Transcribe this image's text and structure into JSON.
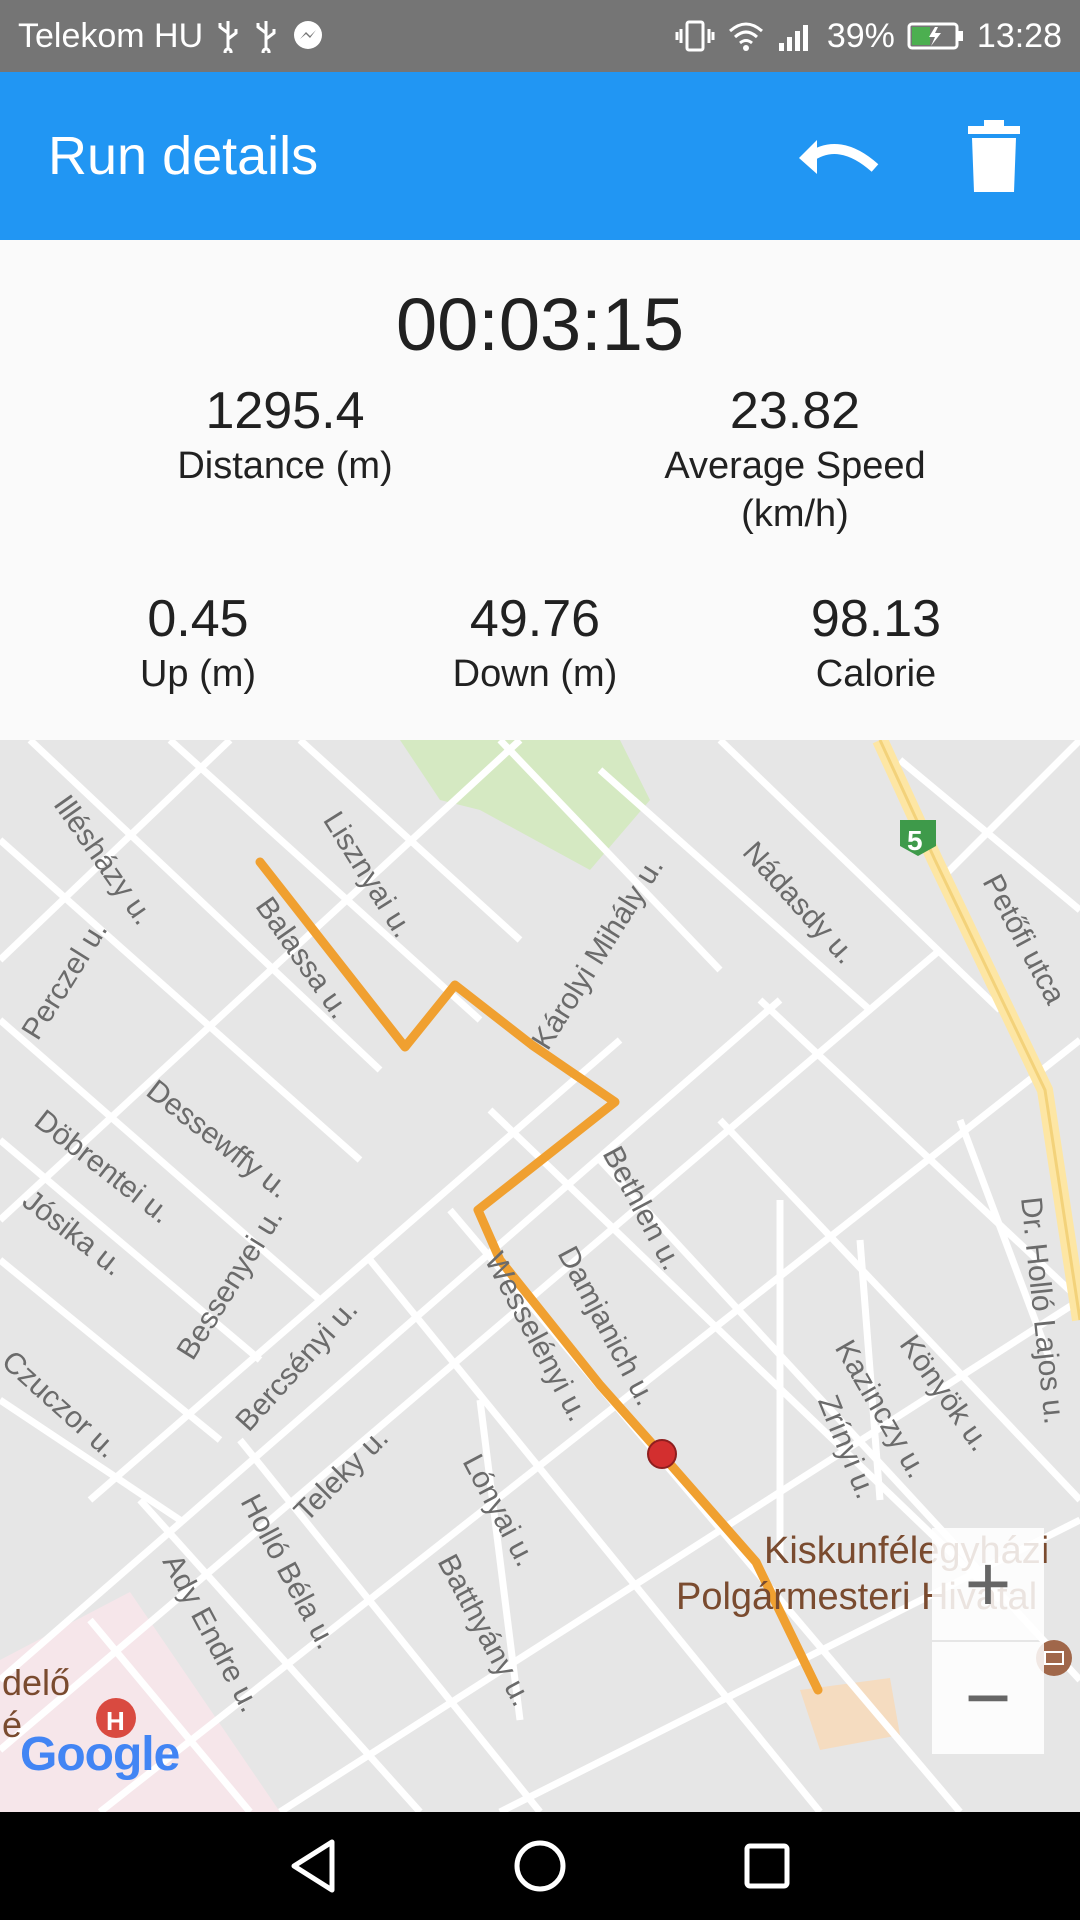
{
  "status_bar": {
    "carrier": "Telekom HU",
    "battery": "39%",
    "time": "13:28"
  },
  "app_bar": {
    "title": "Run details",
    "actions": [
      "undo-icon",
      "delete-icon"
    ]
  },
  "stats": {
    "duration": "00:03:15",
    "distance": {
      "value": "1295.4",
      "label": "Distance (m)"
    },
    "avg_speed": {
      "value": "23.82",
      "label_line1": "Average Speed",
      "label_line2": "(km/h)"
    },
    "up": {
      "value": "0.45",
      "label": "Up (m)"
    },
    "down": {
      "value": "49.76",
      "label": "Down (m)"
    },
    "calorie": {
      "value": "98.13",
      "label": "Calorie"
    }
  },
  "map": {
    "streets": [
      "Illésházy u.",
      "Lisznyai u.",
      "Balassa u.",
      "Károlyi Mihály u.",
      "Nádasdy u.",
      "Petőfi utca",
      "Perczel u.",
      "Dessewffy u.",
      "Döbrentei u.",
      "Jósika u.",
      "Bethlen u.",
      "Dr. Holló Lajos u.",
      "Bessenyei u.",
      "Wesselényi u.",
      "Damjanich u.",
      "Czuczor u.",
      "Bercsényi u.",
      "Kazinczy u.",
      "Könyök u.",
      "Zrínyi u.",
      "Teleky u.",
      "Lónyai u.",
      "Holló Béla u.",
      "Ady Endre u.",
      "Batthyány u."
    ],
    "road_shield": "5",
    "poi_line1": "Kiskunfélegyházi",
    "poi_line2": "Polgármesteri Hivatal",
    "partial_label_1": "delő",
    "partial_label_2": "é",
    "hospital_marker": "H",
    "zoom_in": "+",
    "zoom_out": "−",
    "attribution": "Google",
    "route_color": "#f0a030",
    "marker_color": "#d32f2f"
  },
  "nav_bar": {
    "buttons": [
      "back-icon",
      "home-icon",
      "recents-icon"
    ]
  }
}
